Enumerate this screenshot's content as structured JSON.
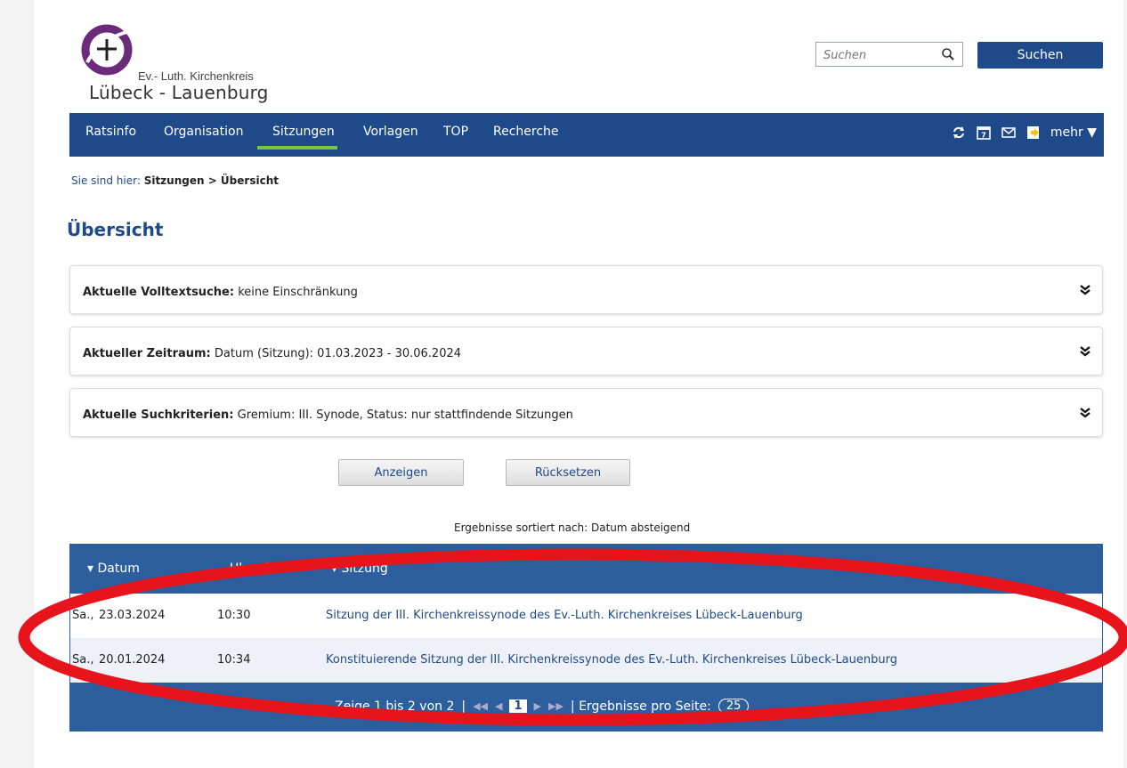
{
  "brand": {
    "symbol": "+",
    "org_line": "Ev.- Luth. Kirchenkreis",
    "name_line": "Lübeck - Lauenburg",
    "accent_color": "#6b2a7a"
  },
  "search": {
    "placeholder": "Suchen",
    "button_label": "Suchen"
  },
  "nav": {
    "items": [
      {
        "label": "Ratsinfo"
      },
      {
        "label": "Organisation"
      },
      {
        "label": "Sitzungen",
        "active": true
      },
      {
        "label": "Vorlagen"
      },
      {
        "label": "TOP"
      },
      {
        "label": "Recherche"
      }
    ],
    "icons": [
      "refresh-icon",
      "calendar-icon",
      "mail-icon",
      "export-icon"
    ],
    "calendar_number": "7",
    "more_label": "mehr ▼",
    "bg_color": "#1f4a8a",
    "active_underline_color": "#7fc242"
  },
  "breadcrumb": {
    "prefix": "Sie sind hier:",
    "path": "Sitzungen > Übersicht"
  },
  "page_title": "Übersicht",
  "filters": [
    {
      "label": "Aktuelle Volltextsuche:",
      "value": "keine Einschränkung"
    },
    {
      "label": "Aktueller Zeitraum:",
      "value": "Datum (Sitzung): 01.03.2023 - 30.06.2024"
    },
    {
      "label": "Aktuelle Suchkriterien:",
      "value": "Gremium: III. Synode, Status: nur stattfindende Sitzungen"
    }
  ],
  "buttons": {
    "show": "Anzeigen",
    "reset": "Rücksetzen"
  },
  "sort_info": "Ergebnisse sortiert nach: Datum absteigend",
  "table": {
    "headers": [
      "Datum",
      "Uhrzeit",
      "Sitzung"
    ],
    "rows": [
      {
        "day": "Sa.,",
        "date": "23.03.2024",
        "time": "10:30",
        "title": "Sitzung der III. Kirchenkreissynode des Ev.-Luth. Kirchenkreises Lübeck-Lauenburg"
      },
      {
        "day": "Sa.,",
        "date": "20.01.2024",
        "time": "10:34",
        "title": "Konstituierende Sitzung der III. Kirchenkreissynode des Ev.-Luth. Kirchenkreises Lübeck-Lauenburg"
      }
    ],
    "pager": {
      "summary": "Zeige 1 bis 2 von 2",
      "current_page": "1",
      "per_page_label": "| Ergebnisse pro Seite:",
      "per_page_value": "25"
    }
  },
  "annotation_color": "#e8141b"
}
